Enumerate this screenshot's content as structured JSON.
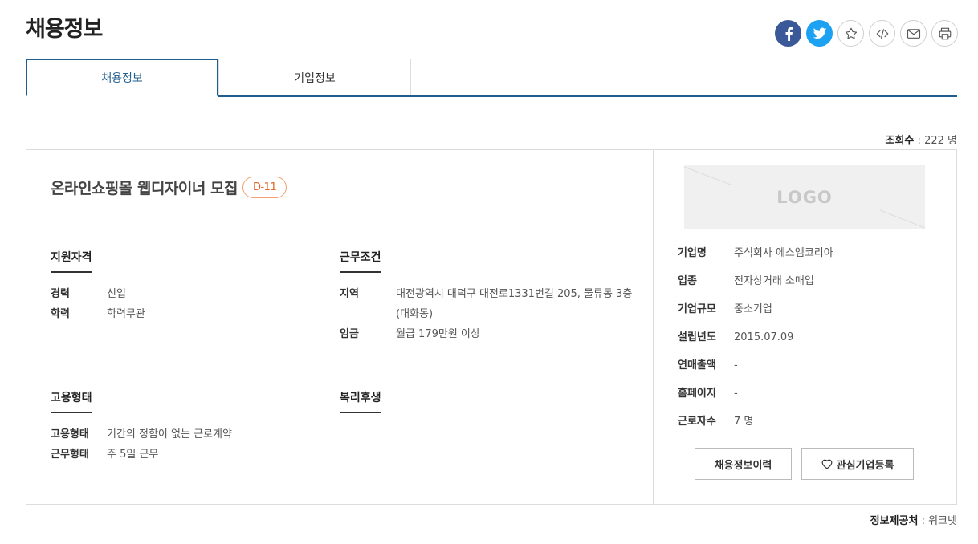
{
  "page": {
    "title": "채용정보"
  },
  "share": {
    "icons": [
      "facebook-icon",
      "twitter-icon",
      "star-icon",
      "code-icon",
      "mail-icon",
      "print-icon"
    ],
    "colors": {
      "facebook": "#3b5998",
      "twitter": "#1da1f2"
    }
  },
  "tabs": [
    {
      "label": "채용정보",
      "active": true
    },
    {
      "label": "기업정보",
      "active": false
    }
  ],
  "views": {
    "label": "조회수",
    "value": "222",
    "unit": "명"
  },
  "job": {
    "title": "온라인쇼핑몰 웹디자이너 모집",
    "dday": "D-11",
    "qualification": {
      "title": "지원자격",
      "rows": [
        {
          "k": "경력",
          "v": "신입"
        },
        {
          "k": "학력",
          "v": "학력무관"
        }
      ]
    },
    "conditions": {
      "title": "근무조건",
      "rows": [
        {
          "k": "지역",
          "v": "대전광역시 대덕구 대전로1331번길 205, 물류동 3층 (대화동)"
        },
        {
          "k": "임금",
          "v": "월급 179만원 이상"
        }
      ]
    },
    "employment": {
      "title": "고용형태",
      "rows": [
        {
          "k": "고용형태",
          "v": "기간의 정함이 없는 근로계약"
        },
        {
          "k": "근무형태",
          "v": "주 5일 근무"
        }
      ]
    },
    "welfare": {
      "title": "복리후생"
    }
  },
  "company": {
    "logo_text": "LOGO",
    "rows": [
      {
        "k": "기업명",
        "v": "주식회사 에스엠코리아"
      },
      {
        "k": "업종",
        "v": "전자상거래 소매업"
      },
      {
        "k": "기업규모",
        "v": "중소기업"
      },
      {
        "k": "설립년도",
        "v": "2015.07.09"
      },
      {
        "k": "연매출액",
        "v": "-"
      },
      {
        "k": "홈페이지",
        "v": "-"
      },
      {
        "k": "근로자수",
        "v": "7 명"
      }
    ],
    "history_button": "채용정보이력",
    "favorite_button": "관심기업등록"
  },
  "source": {
    "label": "정보제공처",
    "value": "워크넷"
  },
  "accent": "#1f5d8e",
  "dday_color": "#e0662a"
}
